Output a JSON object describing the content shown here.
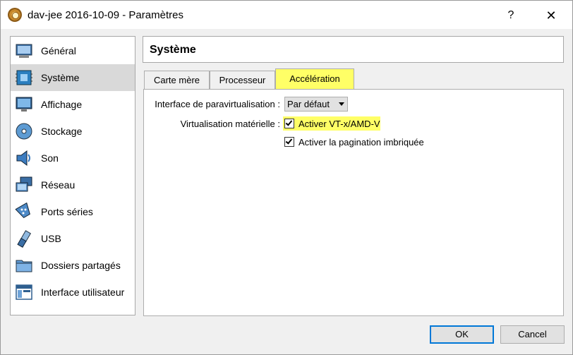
{
  "window": {
    "title": "dav-jee 2016-10-09 - Paramètres",
    "help_label": "?",
    "close_label": "✕"
  },
  "sidebar": {
    "items": [
      {
        "label": "Général",
        "icon": "general-icon"
      },
      {
        "label": "Système",
        "icon": "system-icon",
        "selected": true
      },
      {
        "label": "Affichage",
        "icon": "display-icon"
      },
      {
        "label": "Stockage",
        "icon": "storage-icon"
      },
      {
        "label": "Son",
        "icon": "sound-icon"
      },
      {
        "label": "Réseau",
        "icon": "network-icon"
      },
      {
        "label": "Ports séries",
        "icon": "serial-ports-icon"
      },
      {
        "label": "USB",
        "icon": "usb-icon"
      },
      {
        "label": "Dossiers partagés",
        "icon": "shared-folders-icon"
      },
      {
        "label": "Interface utilisateur",
        "icon": "user-interface-icon"
      }
    ]
  },
  "main": {
    "header_title": "Système",
    "tabs": [
      {
        "label": "Carte mère"
      },
      {
        "label": "Processeur"
      },
      {
        "label": "Accélération",
        "active": true
      }
    ],
    "paravirt": {
      "label": "Interface de paravirtualisation :",
      "value": "Par défaut"
    },
    "hw_virt": {
      "label": "Virtualisation matérielle :",
      "option1": {
        "label": "Activer VT-x/AMD-V",
        "checked": true
      },
      "option2": {
        "label": "Activer la pagination imbriquée",
        "checked": true
      }
    }
  },
  "footer": {
    "ok_label": "OK",
    "cancel_label": "Cancel"
  },
  "colors": {
    "highlight": "#ffff66",
    "selected_item": "#d9d9d9",
    "default_button_border": "#0078d7"
  }
}
